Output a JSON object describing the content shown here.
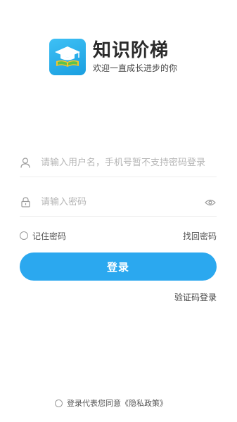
{
  "brand": {
    "app_name": "知识阶梯",
    "slogan": "欢迎一直成长进步的你"
  },
  "login_form": {
    "username_placeholder": "请输入用户名，手机号暂不支持密码登录",
    "password_placeholder": "请输入密码",
    "remember_label": "记住密码",
    "forgot_label": "找回密码",
    "login_button": "登录",
    "sms_login": "验证码登录"
  },
  "footer": {
    "agree_text": "登录代表您同意",
    "policy_link": "《隐私政策》"
  },
  "colors": {
    "accent": "#2ba8ef",
    "logo": "#1a9fe0"
  }
}
